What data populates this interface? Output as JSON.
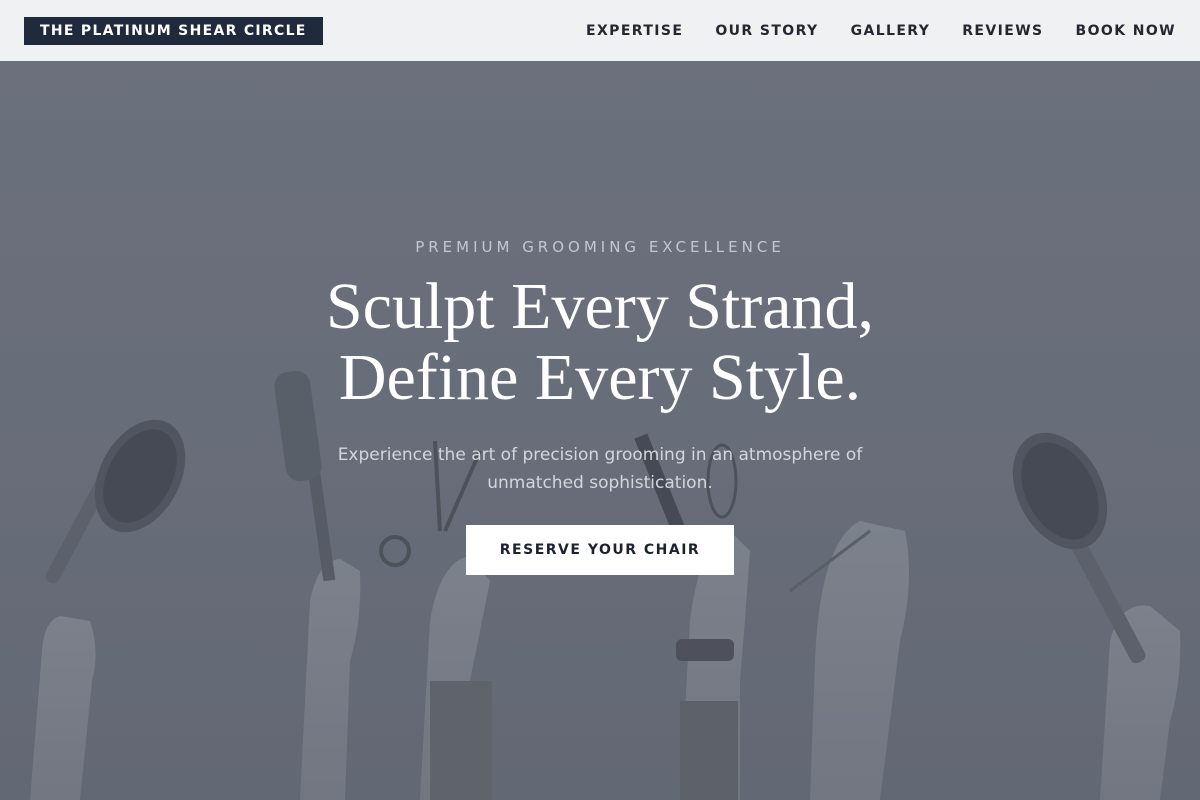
{
  "brand": {
    "name": "THE PLATINUM SHEAR CIRCLE",
    "bg_color": "#1f2a3d"
  },
  "nav": {
    "items": [
      {
        "label": "EXPERTISE"
      },
      {
        "label": "OUR STORY"
      },
      {
        "label": "GALLERY"
      },
      {
        "label": "REVIEWS"
      },
      {
        "label": "BOOK NOW"
      }
    ]
  },
  "hero": {
    "eyebrow": "PREMIUM GROOMING EXCELLENCE",
    "headline_line1": "Sculpt Every Strand,",
    "headline_line2": "Define Every Style.",
    "subtext": "Experience the art of precision grooming in an atmosphere of unmatched sophistication.",
    "cta_label": "RESERVE YOUR CHAIR",
    "overlay_color": "#6b707c",
    "background_image": "raised-hands-holding-hair-tools"
  }
}
